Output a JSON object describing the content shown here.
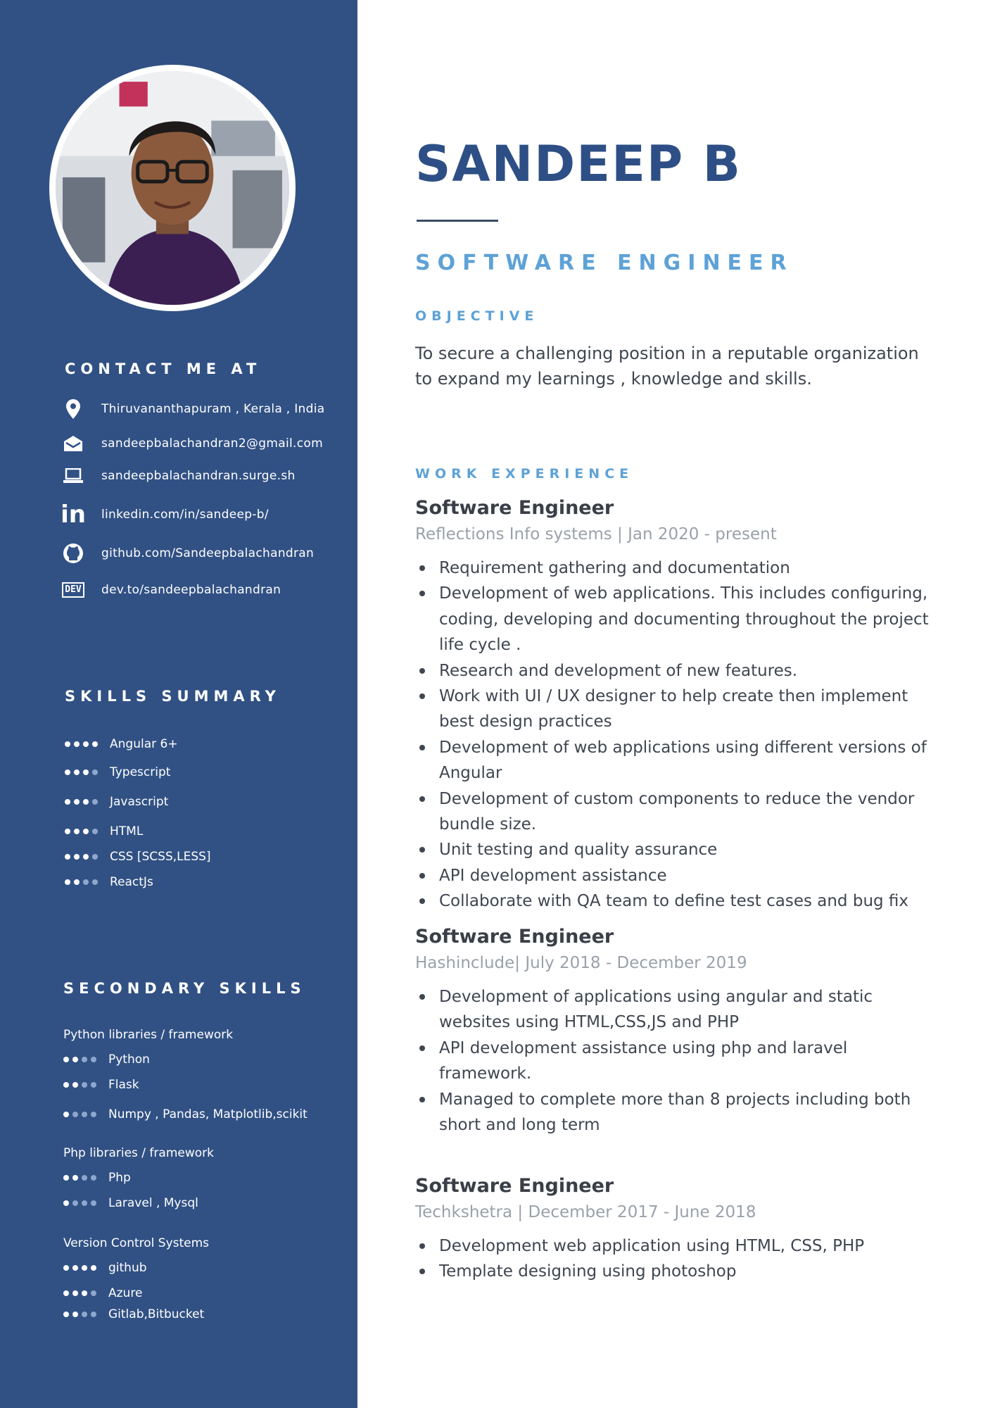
{
  "profile": {
    "name": "SANDEEP B",
    "role": "SOFTWARE ENGINEER"
  },
  "objective": {
    "heading": "OBJECTIVE",
    "text": "To secure a challenging position in a reputable organization to expand my learnings , knowledge and skills."
  },
  "contact": {
    "heading": "CONTACT ME AT",
    "items": [
      {
        "icon": "location-pin-icon",
        "text": "Thiruvananthapuram , Kerala , India"
      },
      {
        "icon": "mail-icon",
        "text": "sandeepbalachandran2@gmail.com"
      },
      {
        "icon": "laptop-icon",
        "text": "sandeepbalachandran.surge.sh"
      },
      {
        "icon": "linkedin-icon",
        "text": "linkedin.com/in/sandeep-b/"
      },
      {
        "icon": "github-icon",
        "text": "github.com/Sandeepbalachandran"
      },
      {
        "icon": "dev-icon",
        "text": "dev.to/sandeepbalachandran"
      }
    ]
  },
  "dev_badge": "DEV",
  "linkedin_badge": "in",
  "skills": {
    "heading": "SKILLS SUMMARY",
    "items": [
      {
        "label": "Angular 6+",
        "level": 4
      },
      {
        "label": "Typescript",
        "level": 3
      },
      {
        "label": "Javascript",
        "level": 3
      },
      {
        "label": "HTML",
        "level": 3
      },
      {
        "label": "CSS [SCSS,LESS]",
        "level": 3
      },
      {
        "label": "ReactJs",
        "level": 2
      }
    ]
  },
  "secondary": {
    "heading": "SECONDARY SKILLS",
    "groups": [
      {
        "title": "Python libraries / framework",
        "items": [
          {
            "label": "Python",
            "level": 2
          },
          {
            "label": "Flask",
            "level": 2
          },
          {
            "label": "Numpy , Pandas, Matplotlib,scikit",
            "level": 1
          }
        ]
      },
      {
        "title": "Php libraries / framework",
        "items": [
          {
            "label": "Php",
            "level": 2
          },
          {
            "label": "Laravel , Mysql",
            "level": 1
          }
        ]
      },
      {
        "title": "Version Control Systems",
        "items": [
          {
            "label": "github",
            "level": 4
          },
          {
            "label": "Azure",
            "level": 3
          },
          {
            "label": "Gitlab,Bitbucket",
            "level": 2
          }
        ]
      }
    ]
  },
  "experience": {
    "heading": "WORK EXPERIENCE",
    "jobs": [
      {
        "title": "Software Engineer",
        "meta": "Reflections Info systems | Jan 2020 - present",
        "bullets": [
          "Requirement gathering and documentation",
          "Development of web applications. This includes configuring, coding, developing and documenting throughout the project life cycle .",
          "Research and development of new features.",
          "Work with UI / UX designer to help create then implement best design practices",
          "Development of web applications using different versions of Angular",
          "Development of custom components to reduce the vendor bundle size.",
          "Unit testing and quality assurance",
          "API development assistance",
          "Collaborate with QA team to define test cases and bug fix"
        ]
      },
      {
        "title": "Software Engineer",
        "meta": "Hashinclude| July 2018 - December 2019",
        "bullets": [
          "Development of applications using angular and static websites using HTML,CSS,JS and PHP",
          " API development assistance using php and laravel framework.",
          "Managed to complete more than 8 projects including both short and long term"
        ]
      },
      {
        "title": "Software Engineer",
        "meta": "Techkshetra | December 2017 - June  2018",
        "bullets": [
          "Development web application using HTML, CSS, PHP",
          "Template designing using photoshop"
        ]
      }
    ]
  },
  "colors": {
    "sidebar": "#315184",
    "name": "#2d4f86",
    "accent": "#5ea2d6",
    "body_text": "#3f4650",
    "muted": "#9aa1a9"
  }
}
